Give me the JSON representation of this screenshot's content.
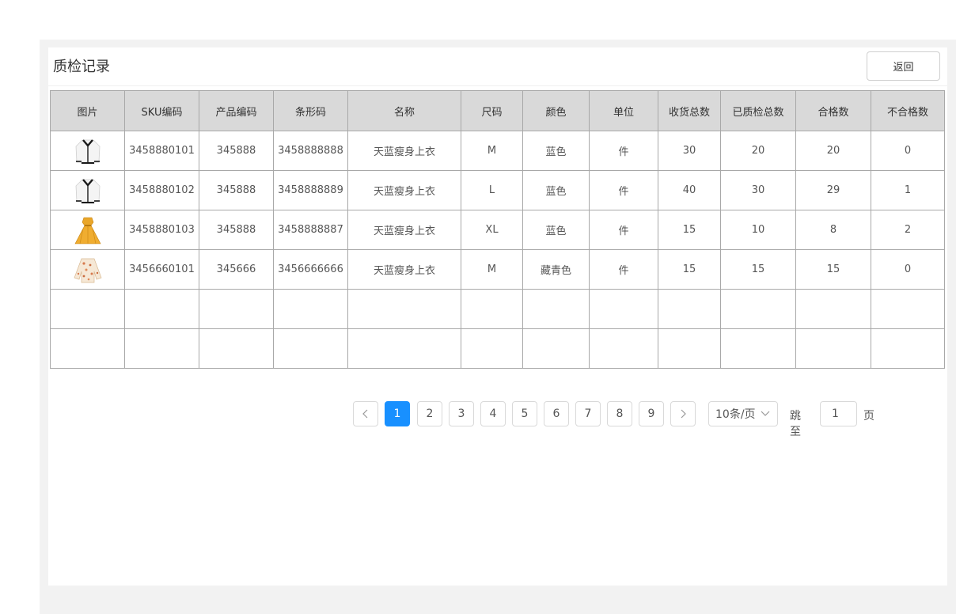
{
  "page": {
    "title": "质检记录",
    "back_label": "返回"
  },
  "table": {
    "columns": [
      "图片",
      "SKU编码",
      "产品编码",
      "条形码",
      "名称",
      "尺码",
      "颜色",
      "单位",
      "收货总数",
      "已质检总数",
      "合格数",
      "不合格数"
    ],
    "rows": [
      {
        "image": "white-cardigan",
        "sku": "3458880101",
        "product_code": "345888",
        "barcode": "3458888888",
        "name": "天蓝瘦身上衣",
        "size": "M",
        "color": "蓝色",
        "unit": "件",
        "received": "30",
        "inspected": "20",
        "qualified": "20",
        "unqualified": "0"
      },
      {
        "image": "white-cardigan",
        "sku": "3458880102",
        "product_code": "345888",
        "barcode": "3458888889",
        "name": "天蓝瘦身上衣",
        "size": "L",
        "color": "蓝色",
        "unit": "件",
        "received": "40",
        "inspected": "30",
        "qualified": "29",
        "unqualified": "1"
      },
      {
        "image": "yellow-dress",
        "sku": "3458880103",
        "product_code": "345888",
        "barcode": "3458888887",
        "name": "天蓝瘦身上衣",
        "size": "XL",
        "color": "蓝色",
        "unit": "件",
        "received": "15",
        "inspected": "10",
        "qualified": "8",
        "unqualified": "2"
      },
      {
        "image": "floral-blouse",
        "sku": "3456660101",
        "product_code": "345666",
        "barcode": "3456666666",
        "name": "天蓝瘦身上衣",
        "size": "M",
        "color": "藏青色",
        "unit": "件",
        "received": "15",
        "inspected": "15",
        "qualified": "15",
        "unqualified": "0"
      }
    ]
  },
  "pagination": {
    "prev_icon": "chevron-left-icon",
    "next_icon": "chevron-right-icon",
    "pages": [
      "1",
      "2",
      "3",
      "4",
      "5",
      "6",
      "7",
      "8",
      "9"
    ],
    "current": "1",
    "page_size": "10条/页",
    "jump_label": "跳至",
    "jump_value": "1",
    "page_suffix": "页"
  },
  "colors": {
    "accent": "#1890ff",
    "danger": "#d9001b",
    "header_bg": "#d9d9d9",
    "outer_bg": "#f2f2f2"
  }
}
